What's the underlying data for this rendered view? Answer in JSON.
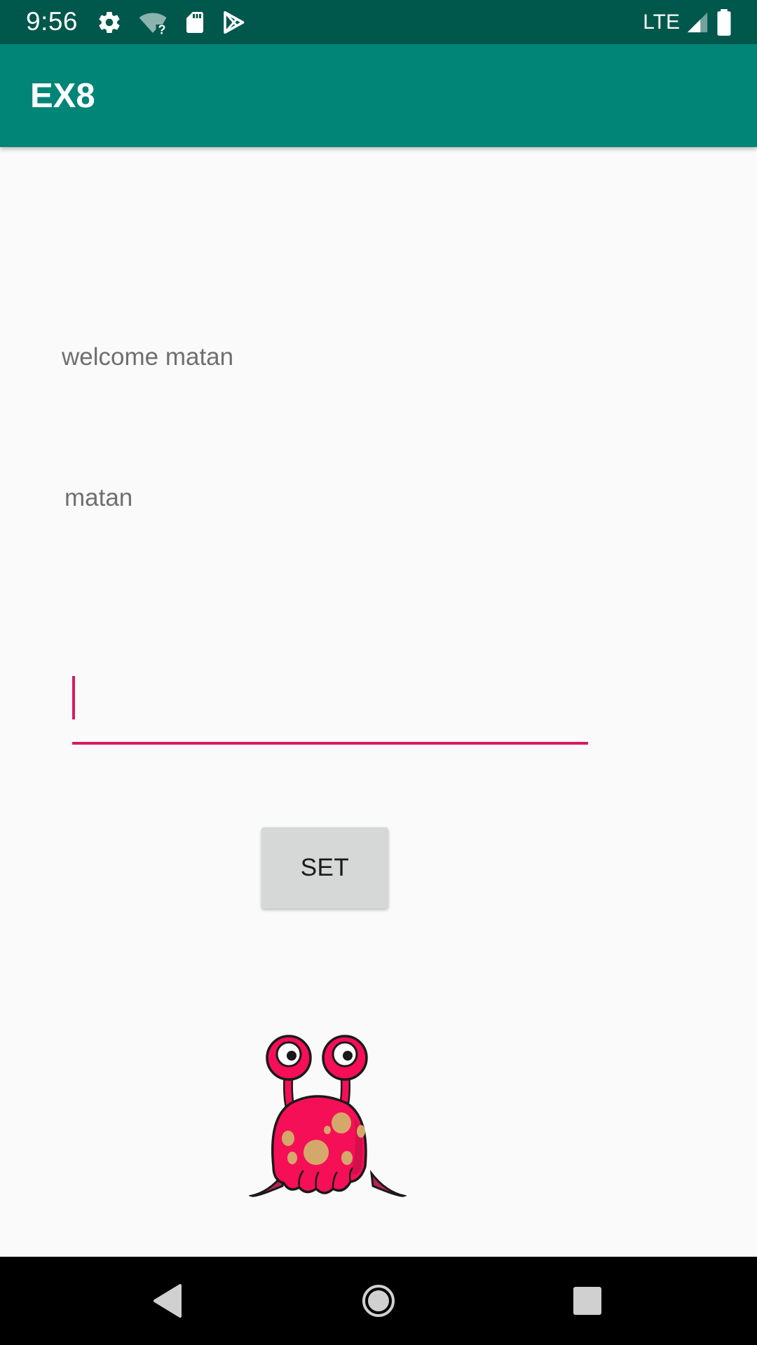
{
  "status_bar": {
    "time": "9:56",
    "network_label": "LTE",
    "icons_left": [
      "gear-icon",
      "wifi-question-icon",
      "sd-card-icon",
      "play-store-icon"
    ],
    "icons_right": [
      "signal-icon",
      "battery-icon"
    ]
  },
  "app_bar": {
    "title": "EX8",
    "color": "#008577"
  },
  "content": {
    "welcome_text": "welcome matan",
    "name_text": "matan",
    "input": {
      "value": "",
      "placeholder": "",
      "accent_color": "#d81b60"
    },
    "set_button_label": "SET",
    "image": "pink-monster-image"
  },
  "nav_bar": {
    "buttons": [
      "back-icon",
      "home-icon",
      "recents-icon"
    ]
  }
}
